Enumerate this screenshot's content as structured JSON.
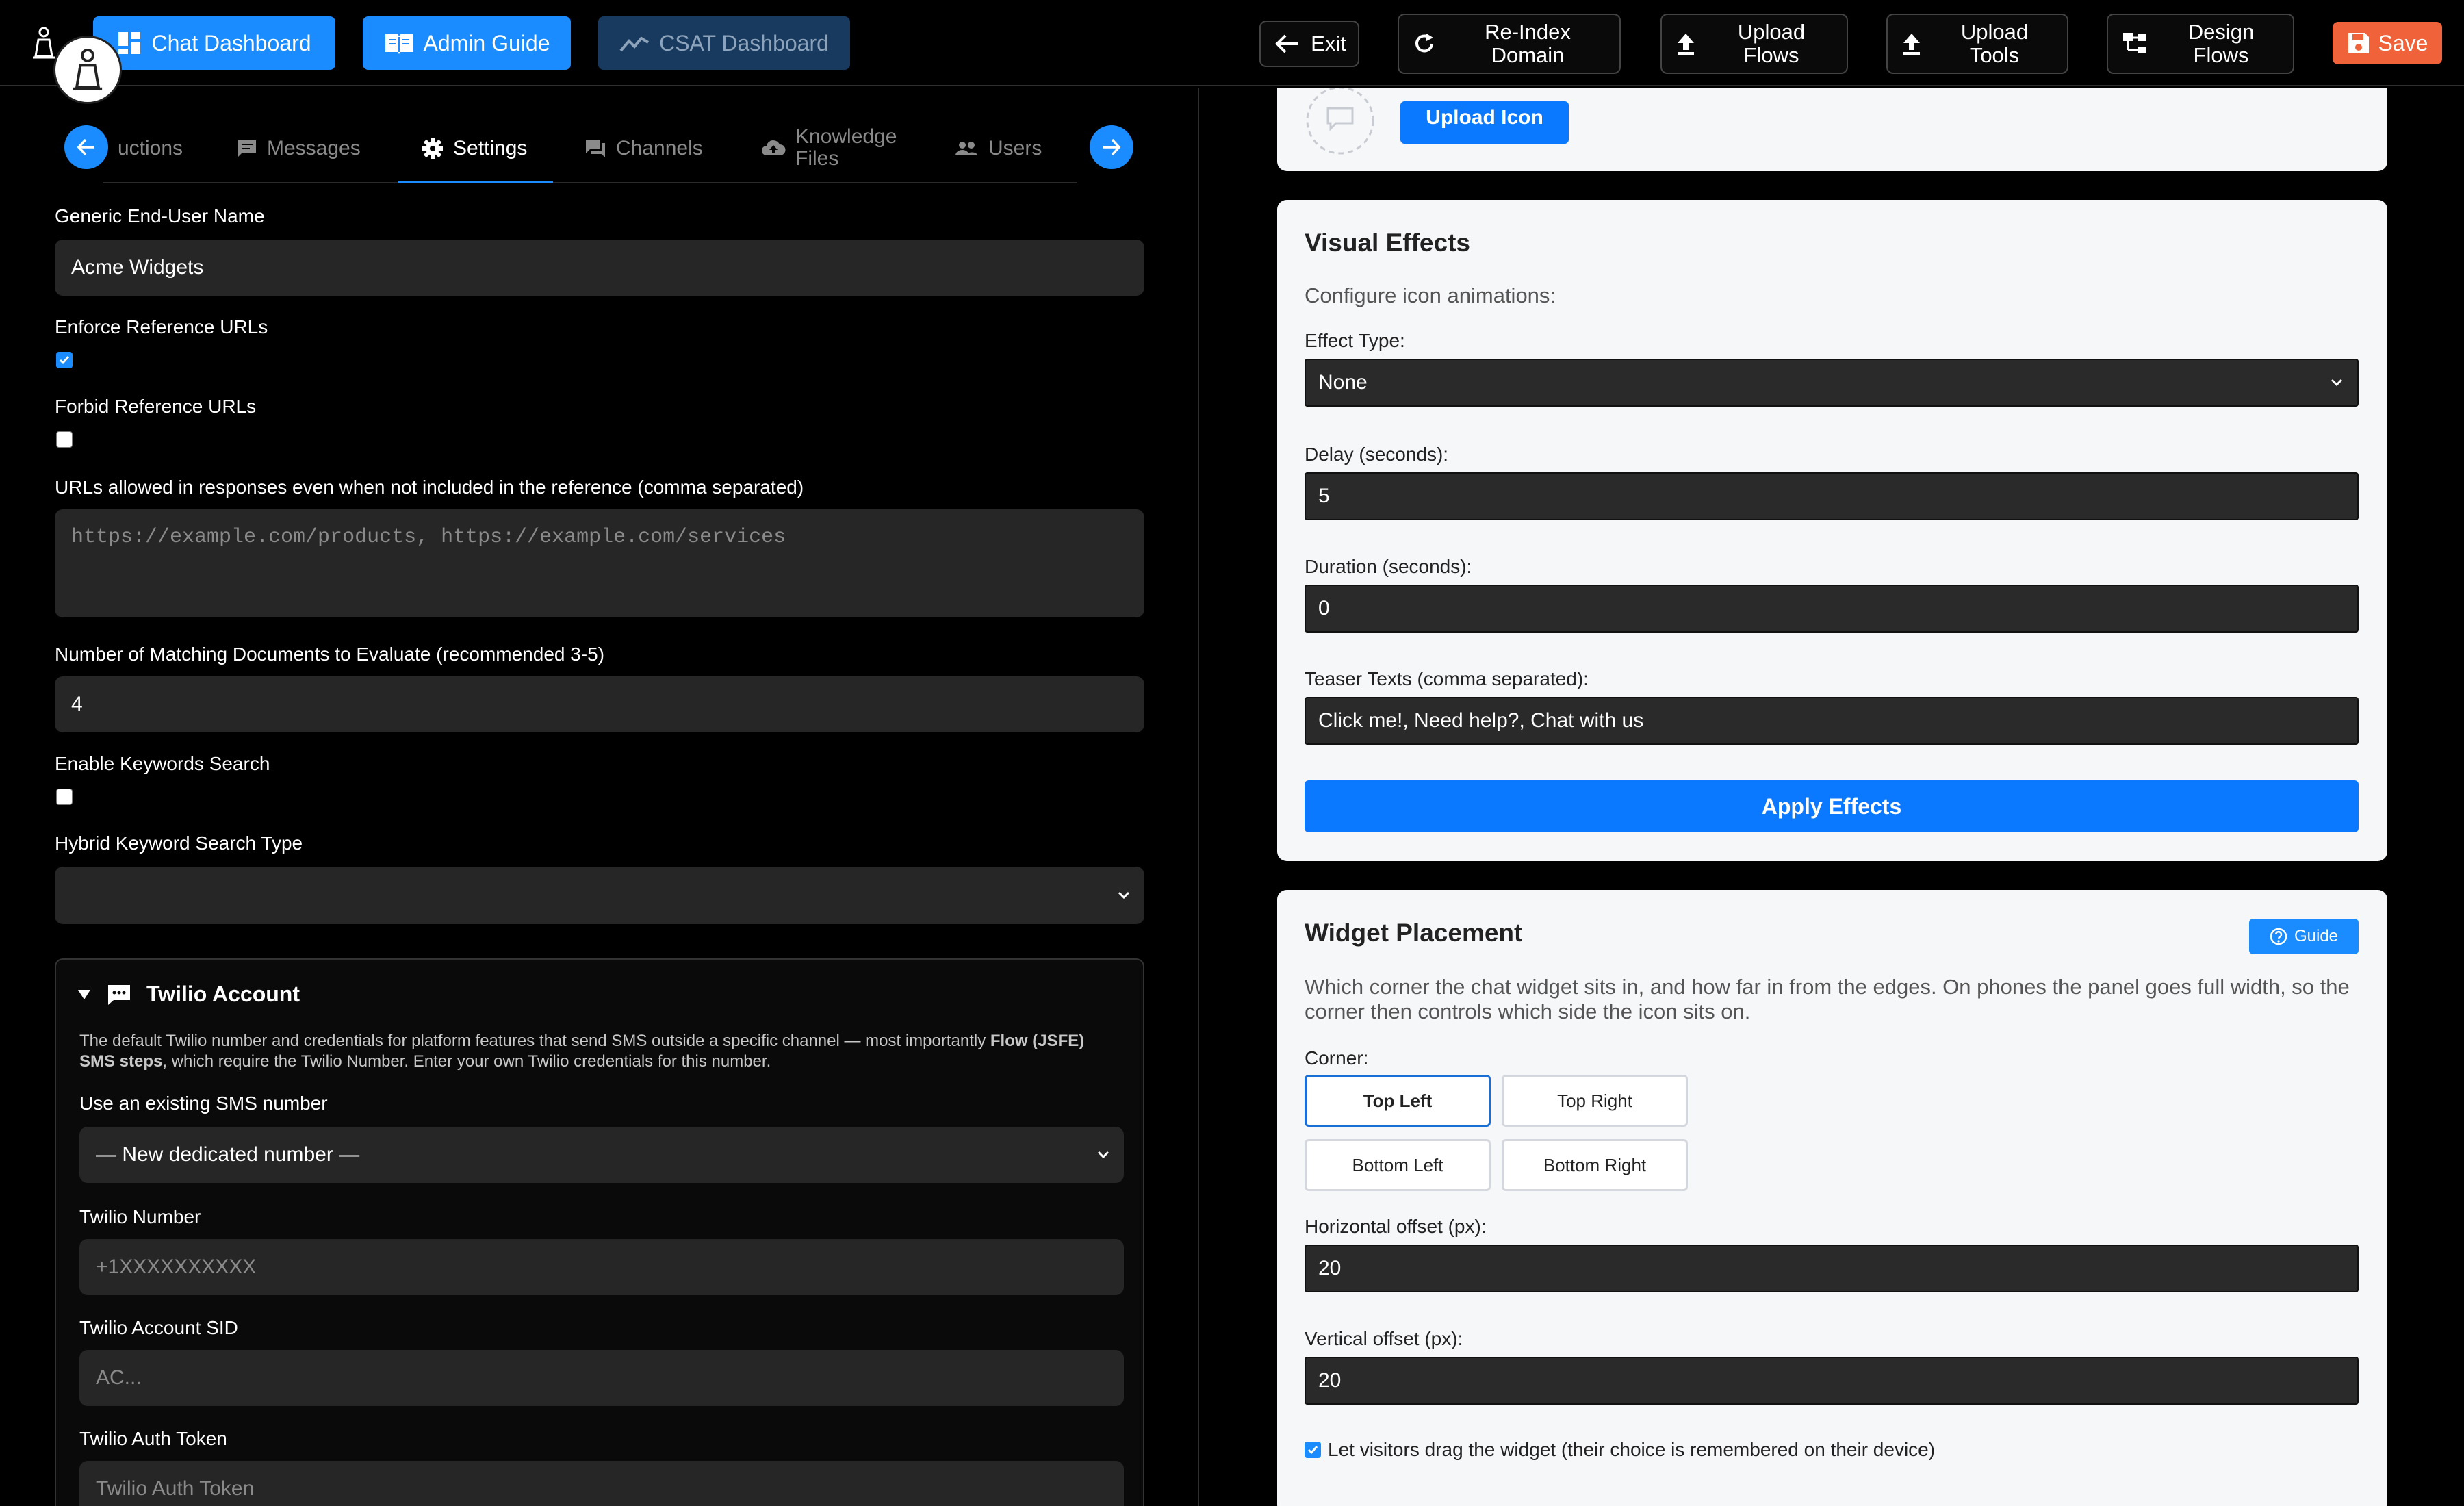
{
  "topbar": {
    "chat_dashboard": "Chat Dashboard",
    "admin_guide": "Admin Guide",
    "csat_dashboard": "CSAT Dashboard",
    "exit": "Exit",
    "reindex_line1": "Re-Index",
    "reindex_line2": "Domain",
    "upload_flows_line1": "Upload",
    "upload_flows_line2": "Flows",
    "upload_tools_line1": "Upload",
    "upload_tools_line2": "Tools",
    "design_flows_line1": "Design",
    "design_flows_line2": "Flows",
    "save": "Save"
  },
  "tabs": {
    "instructions": "uctions",
    "messages": "Messages",
    "settings": "Settings",
    "channels": "Channels",
    "knowledge_line1": "Knowledge",
    "knowledge_line2": "Files",
    "users": "Users"
  },
  "settings": {
    "end_user_name_label": "Generic End-User Name",
    "end_user_name_value": "Acme Widgets",
    "enforce_urls_label": "Enforce Reference URLs",
    "enforce_urls_checked": true,
    "forbid_urls_label": "Forbid Reference URLs",
    "forbid_urls_checked": false,
    "allowed_urls_label": "URLs allowed in responses even when not included in the reference (comma separated)",
    "allowed_urls_placeholder": "https://example.com/products, https://example.com/services",
    "matching_docs_label": "Number of Matching Documents to Evaluate (recommended 3-5)",
    "matching_docs_value": "4",
    "keywords_search_label": "Enable Keywords Search",
    "keywords_search_checked": false,
    "hybrid_type_label": "Hybrid Keyword Search Type",
    "hybrid_type_value": ""
  },
  "twilio": {
    "title": "Twilio Account",
    "desc_part1": "The default Twilio number and credentials for platform features that send SMS outside a specific channel — most importantly ",
    "desc_bold": "Flow (JSFE) SMS steps",
    "desc_part2": ", which require the Twilio Number. Enter your own Twilio credentials for this number.",
    "existing_label": "Use an existing SMS number",
    "existing_value": "— New dedicated number —",
    "number_label": "Twilio Number",
    "number_placeholder": "+1XXXXXXXXXX",
    "sid_label": "Twilio Account SID",
    "sid_placeholder": "AC...",
    "token_label": "Twilio Auth Token",
    "token_placeholder": "Twilio Auth Token"
  },
  "icon_card": {
    "upload_icon": "Upload Icon"
  },
  "visual_effects": {
    "title": "Visual Effects",
    "subtitle": "Configure icon animations:",
    "effect_type_label": "Effect Type:",
    "effect_type_value": "None",
    "delay_label": "Delay (seconds):",
    "delay_value": "5",
    "duration_label": "Duration (seconds):",
    "duration_value": "0",
    "teaser_label": "Teaser Texts (comma separated):",
    "teaser_value": "Click me!, Need help?, Chat with us",
    "apply": "Apply Effects"
  },
  "placement": {
    "title": "Widget Placement",
    "guide": "Guide",
    "desc": "Which corner the chat widget sits in, and how far in from the edges. On phones the panel goes full width, so the corner then controls which side the icon sits on.",
    "corner_label": "Corner:",
    "top_left": "Top Left",
    "top_right": "Top Right",
    "bottom_left": "Bottom Left",
    "bottom_right": "Bottom Right",
    "selected_corner": "Top Left",
    "h_offset_label": "Horizontal offset (px):",
    "h_offset_value": "20",
    "v_offset_label": "Vertical offset (px):",
    "v_offset_value": "20",
    "drag_label": "Let visitors drag the widget (their choice is remembered on their device)",
    "drag_checked": true
  },
  "colors": {
    "accent": "#1a8cff",
    "save": "#f0633a",
    "apply": "#0a78ff"
  }
}
